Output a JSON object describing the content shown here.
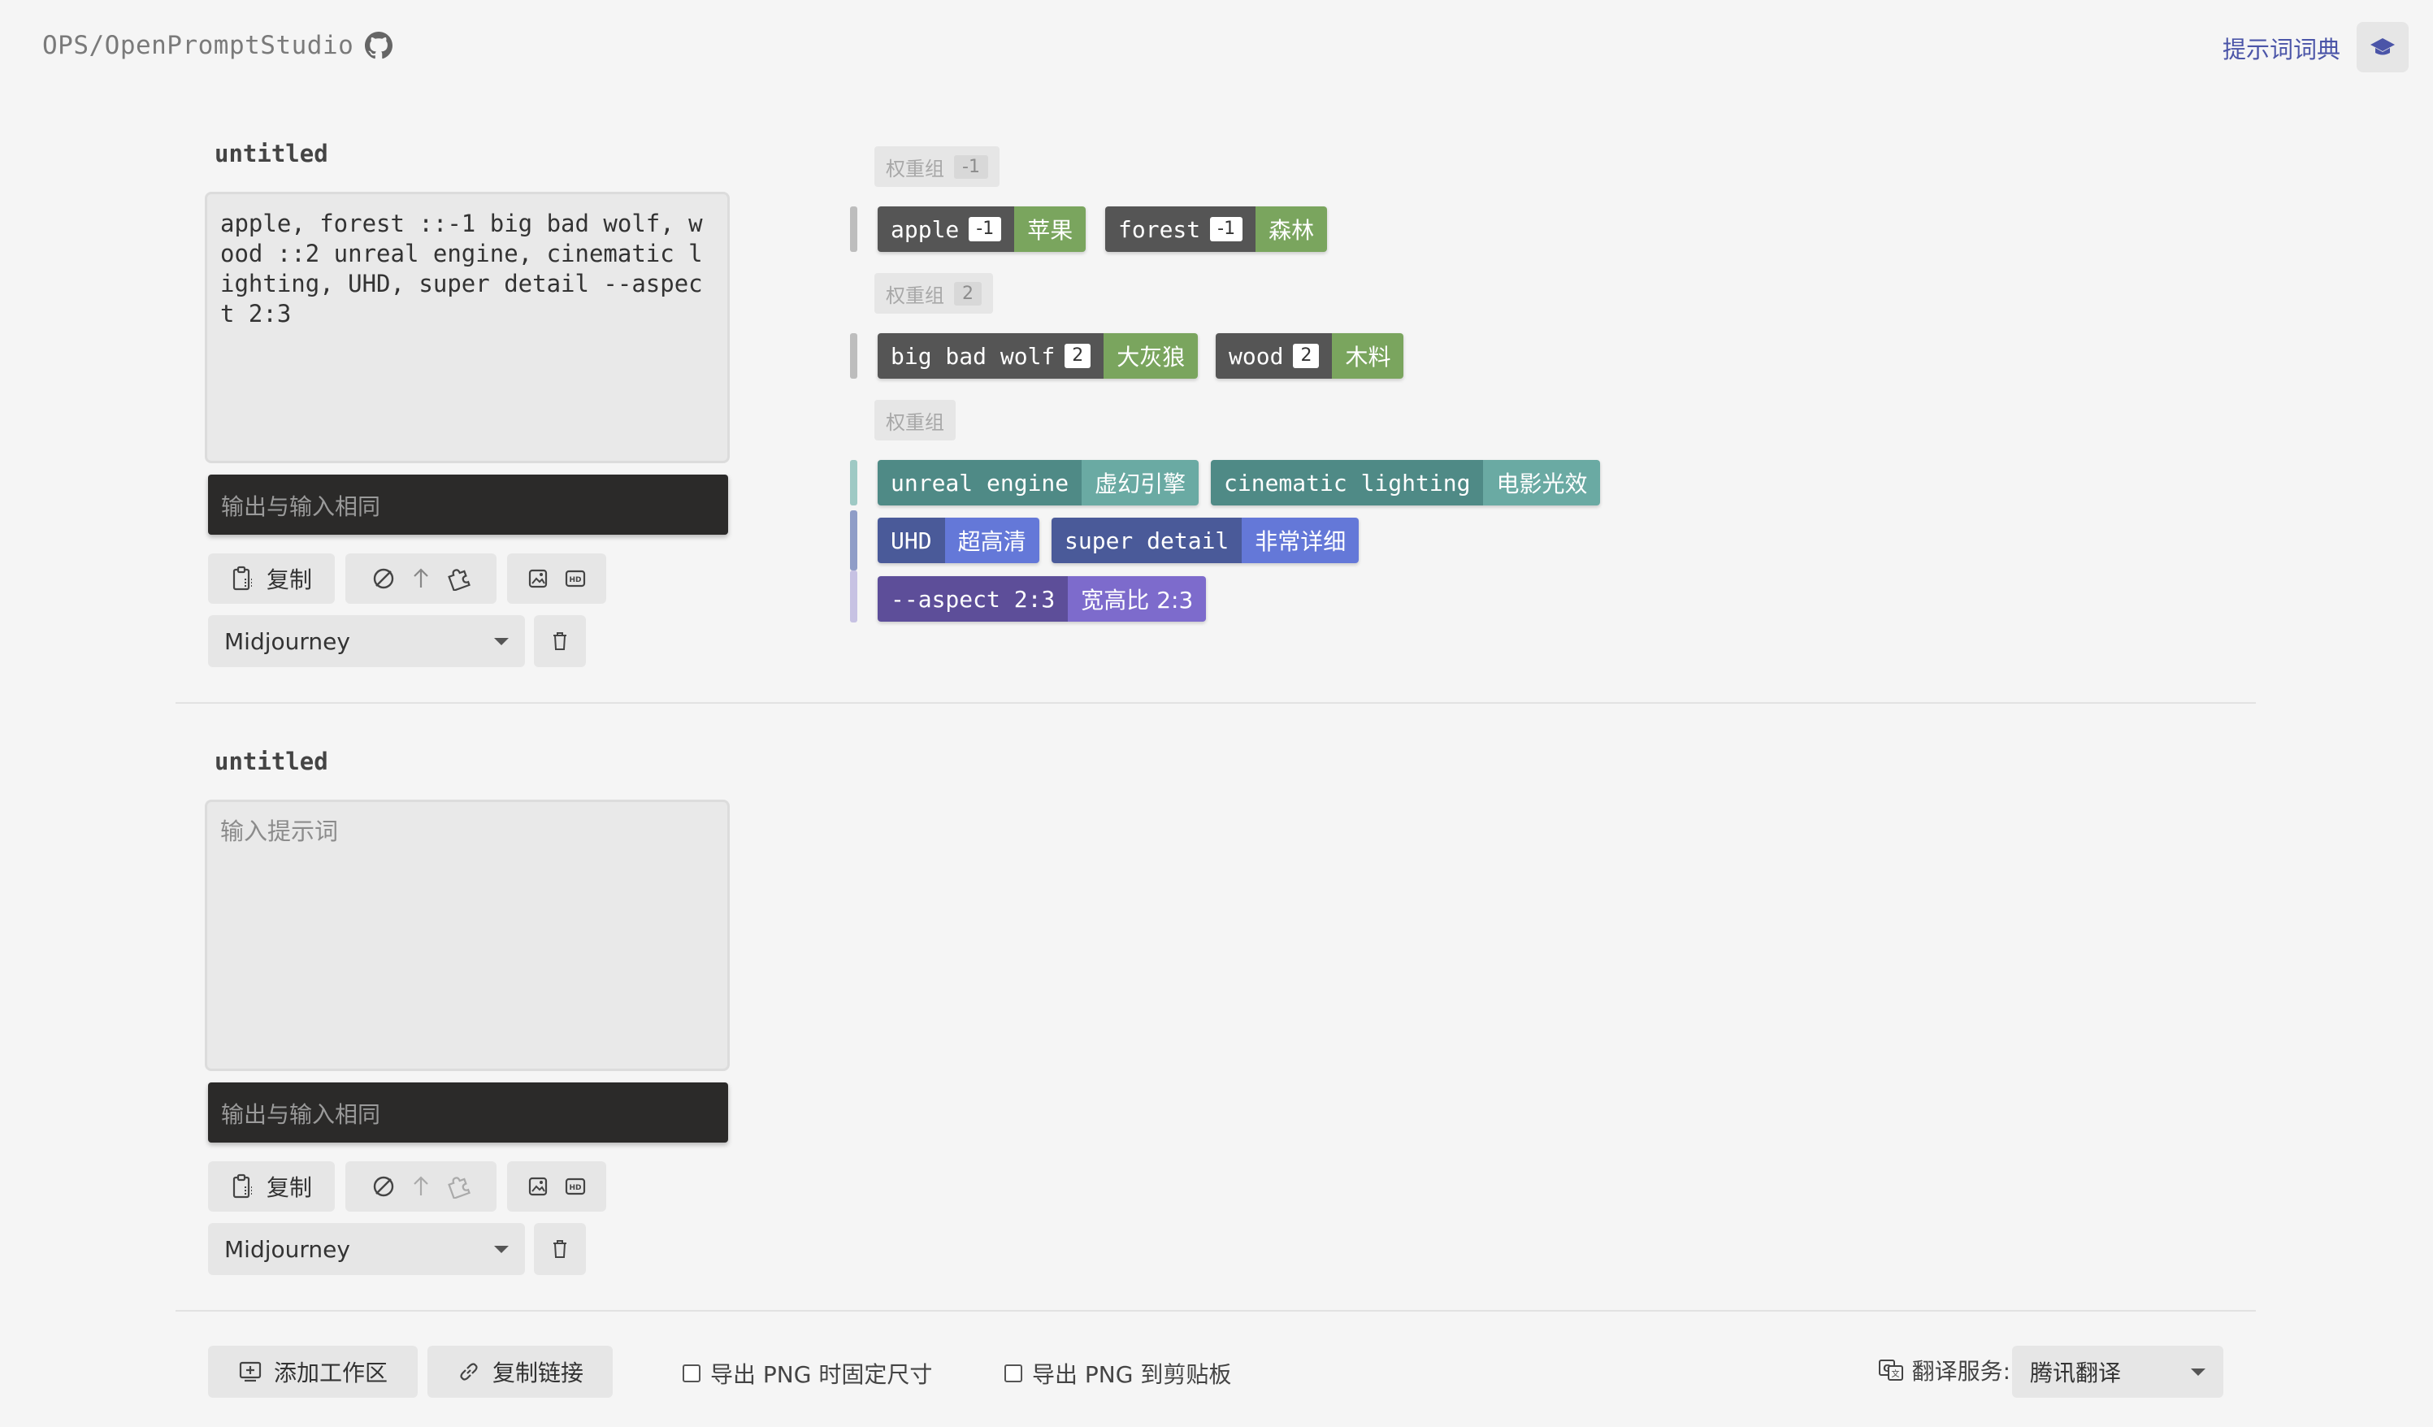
{
  "header": {
    "brand": "OPS/OpenPromptStudio",
    "github_icon": "github-icon",
    "dict_link": "提示词词典",
    "right_icon": "graduation-cap-icon"
  },
  "workspaces": [
    {
      "title": "untitled",
      "prompt": "apple, forest ::-1 big bad wolf, wood ::2 unreal engine, cinematic lighting, UHD, super detail --aspect 2:3",
      "output": "输出与输入相同",
      "copy_label": "复制",
      "engine": "Midjourney"
    },
    {
      "title": "untitled",
      "prompt_placeholder": "输入提示词",
      "output": "输出与输入相同",
      "copy_label": "复制",
      "engine": "Midjourney"
    }
  ],
  "groups": [
    {
      "label": "权重组",
      "weight": "-1",
      "tags": [
        {
          "en": "apple",
          "w": "-1",
          "zh": "苹果"
        },
        {
          "en": "forest",
          "w": "-1",
          "zh": "森林"
        }
      ]
    },
    {
      "label": "权重组",
      "weight": "2",
      "tags": [
        {
          "en": "big bad wolf",
          "w": "2",
          "zh": "大灰狼"
        },
        {
          "en": "wood",
          "w": "2",
          "zh": "木料"
        }
      ]
    },
    {
      "label": "权重组",
      "tags": [
        {
          "en": "unreal engine",
          "zh": "虚幻引擎"
        },
        {
          "en": "cinematic lighting",
          "zh": "电影光效"
        },
        {
          "en": "UHD",
          "zh": "超高清"
        },
        {
          "en": "super detail",
          "zh": "非常详细"
        },
        {
          "en": "--aspect 2:3",
          "zh": "宽高比 2:3"
        }
      ]
    }
  ],
  "colors": {
    "tag_dark": "#555555",
    "tag_green": "#7aa55e",
    "tag_teal_dark": "#4f8a86",
    "tag_teal": "#6aaaa3",
    "tag_blue_dark": "#4a5a99",
    "tag_blue": "#6478d8",
    "tag_purple_dark": "#5d4e99",
    "tag_purple": "#7d6bcc",
    "link": "#4b55a8"
  },
  "footer": {
    "add_workspace": "添加工作区",
    "copy_link": "复制链接",
    "export_fixed": "导出 PNG 时固定尺寸",
    "export_clipboard": "导出 PNG 到剪贴板",
    "translate_label": "翻译服务:",
    "translate_service": "腾讯翻译"
  }
}
